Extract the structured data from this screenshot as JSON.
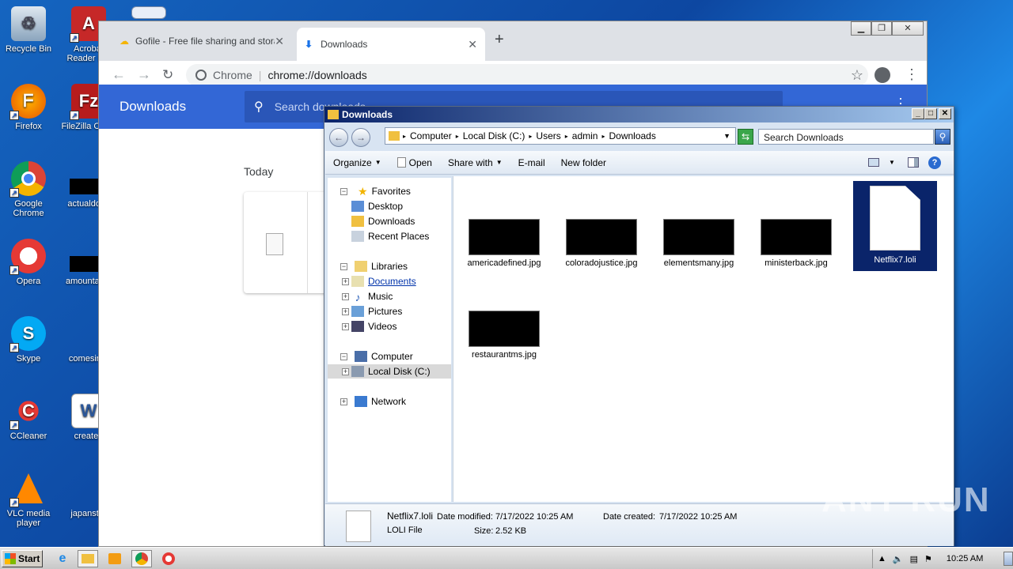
{
  "desktop": {
    "icons": [
      {
        "label": "Recycle Bin"
      },
      {
        "label": "Acrobat Reader DC"
      },
      {
        "label": "Firefox"
      },
      {
        "label": "FileZilla Client"
      },
      {
        "label": "Google Chrome"
      },
      {
        "label": "actualdoes"
      },
      {
        "label": "Opera"
      },
      {
        "label": "amountame"
      },
      {
        "label": "Skype"
      },
      {
        "label": "comesinte"
      },
      {
        "label": "CCleaner"
      },
      {
        "label": "createn"
      },
      {
        "label": "VLC media player"
      },
      {
        "label": "japanstor"
      }
    ]
  },
  "chrome": {
    "tabs": [
      {
        "label": "Gofile - Free file sharing and storage"
      },
      {
        "label": "Downloads"
      }
    ],
    "new_tab": "+",
    "omnibox_site": "Chrome",
    "omnibox_url": "chrome://downloads",
    "page_title": "Downloads",
    "search_placeholder": "Search downloads",
    "date_group": "Today"
  },
  "explorer": {
    "title": "Downloads",
    "breadcrumb": [
      "Computer",
      "Local Disk (C:)",
      "Users",
      "admin",
      "Downloads"
    ],
    "search_placeholder": "Search Downloads",
    "commands": [
      "Organize",
      "Open",
      "Share with",
      "E-mail",
      "New folder"
    ],
    "nav": {
      "favorites": "Favorites",
      "fav_items": [
        "Desktop",
        "Downloads",
        "Recent Places"
      ],
      "libraries": "Libraries",
      "lib_items": [
        "Documents",
        "Music",
        "Pictures",
        "Videos"
      ],
      "computer": "Computer",
      "local_disk": "Local Disk (C:)",
      "network": "Network"
    },
    "files": [
      {
        "name": "americadefined.jpg"
      },
      {
        "name": "coloradojustice.jpg"
      },
      {
        "name": "elementsmany.jpg"
      },
      {
        "name": "ministerback.jpg"
      },
      {
        "name": "Netflix7.loli"
      },
      {
        "name": "restaurantms.jpg"
      }
    ],
    "details": {
      "name": "Netflix7.loli",
      "type": "LOLI File",
      "modified_label": "Date modified:",
      "modified": "7/17/2022 10:25 AM",
      "created_label": "Date created:",
      "created": "7/17/2022 10:25 AM",
      "size_label": "Size:",
      "size": "2.52 KB"
    }
  },
  "taskbar": {
    "start": "Start",
    "clock": "10:25 AM"
  },
  "watermark": "ANY RUN"
}
